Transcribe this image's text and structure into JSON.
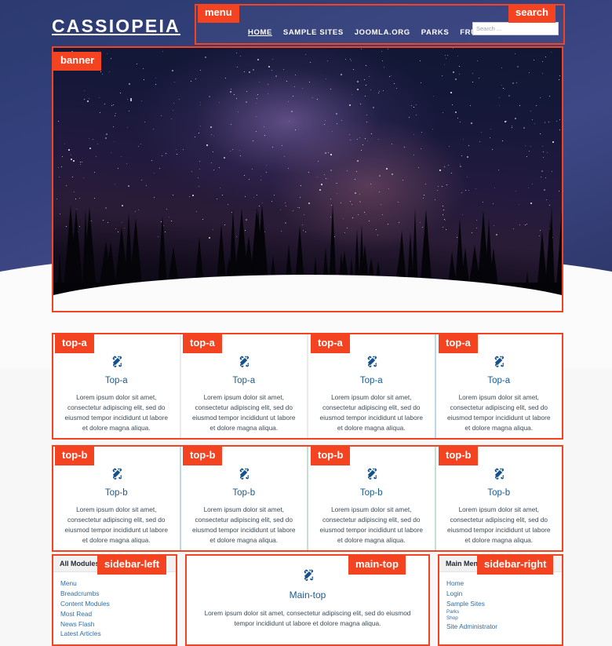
{
  "site": {
    "brand": "CASSIOPEIA",
    "accent_color": "#f44321",
    "header_color": "#2f3a73",
    "link_color": "#2e6ca4"
  },
  "header": {
    "menu_badge": "menu",
    "search_badge": "search",
    "nav": [
      {
        "label": "HOME",
        "active": true
      },
      {
        "label": "SAMPLE SITES",
        "active": false
      },
      {
        "label": "JOOMLA.ORG",
        "active": false
      },
      {
        "label": "PARKS",
        "active": false
      },
      {
        "label": "FRUIT SHOP",
        "active": false
      }
    ],
    "search": {
      "placeholder": "Search ...",
      "value": ""
    }
  },
  "banner": {
    "badge": "banner"
  },
  "rows": [
    {
      "badge": "top-a",
      "cards": [
        {
          "icon": "joomla-icon",
          "title": "Top-a",
          "text": "Lorem ipsum dolor sit amet, consectetur adipiscing elit, sed do eiusmod tempor incididunt ut labore et dolore magna aliqua."
        },
        {
          "icon": "joomla-icon",
          "title": "Top-a",
          "text": "Lorem ipsum dolor sit amet, consectetur adipiscing elit, sed do eiusmod tempor incididunt ut labore et dolore magna aliqua."
        },
        {
          "icon": "joomla-icon",
          "title": "Top-a",
          "text": "Lorem ipsum dolor sit amet, consectetur adipiscing elit, sed do eiusmod tempor incididunt ut labore et dolore magna aliqua."
        },
        {
          "icon": "joomla-icon",
          "title": "Top-a",
          "text": "Lorem ipsum dolor sit amet, consectetur adipiscing elit, sed do eiusmod tempor incididunt ut labore et dolore magna aliqua."
        }
      ]
    },
    {
      "badge": "top-b",
      "cards": [
        {
          "icon": "joomla-icon",
          "title": "Top-b",
          "text": "Lorem ipsum dolor sit amet, consectetur adipiscing elit, sed do eiusmod tempor incididunt ut labore et dolore magna aliqua."
        },
        {
          "icon": "joomla-icon",
          "title": "Top-b",
          "text": "Lorem ipsum dolor sit amet, consectetur adipiscing elit, sed do eiusmod tempor incididunt ut labore et dolore magna aliqua."
        },
        {
          "icon": "joomla-icon",
          "title": "Top-b",
          "text": "Lorem ipsum dolor sit amet, consectetur adipiscing elit, sed do eiusmod tempor incididunt ut labore et dolore magna aliqua."
        },
        {
          "icon": "joomla-icon",
          "title": "Top-b",
          "text": "Lorem ipsum dolor sit amet, consectetur adipiscing elit, sed do eiusmod tempor incididunt ut labore et dolore magna aliqua."
        }
      ]
    }
  ],
  "sidebar_left": {
    "badge": "sidebar-left",
    "heading": "All Modules",
    "items": [
      {
        "label": "Menu",
        "sub": false
      },
      {
        "label": "Breadcrumbs",
        "sub": false
      },
      {
        "label": "Content Modules",
        "sub": false
      },
      {
        "label": "Most Read",
        "sub": false
      },
      {
        "label": "News Flash",
        "sub": false
      },
      {
        "label": "Latest Articles",
        "sub": false
      }
    ]
  },
  "main_top": {
    "badge": "main-top",
    "icon": "joomla-icon",
    "title": "Main-top",
    "text": "Lorem ipsum dolor sit amet, consectetur adipiscing elit, sed do eiusmod tempor incididunt ut labore et dolore magna aliqua."
  },
  "sidebar_right": {
    "badge": "sidebar-right",
    "heading": "Main Menu",
    "items": [
      {
        "label": "Home",
        "sub": false
      },
      {
        "label": "Login",
        "sub": false
      },
      {
        "label": "Sample Sites",
        "sub": false
      },
      {
        "label": "Parks",
        "sub": true
      },
      {
        "label": "Shop",
        "sub": true
      },
      {
        "label": "Site Administrator",
        "sub": false
      }
    ]
  }
}
